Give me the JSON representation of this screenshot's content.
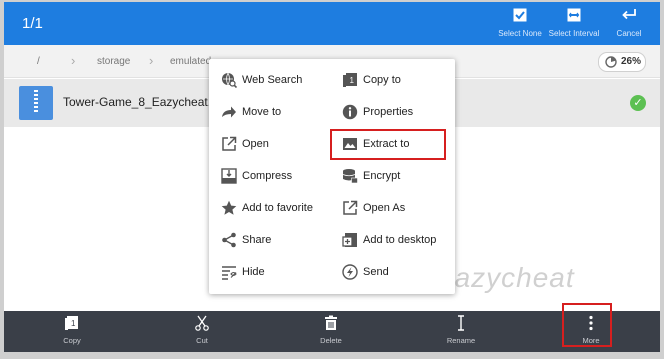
{
  "topbar": {
    "selection_count": "1/1",
    "actions": [
      {
        "label": "Select None",
        "icon": "checkbox-icon"
      },
      {
        "label": "Select Interval",
        "icon": "interval-icon"
      },
      {
        "label": "Cancel",
        "icon": "return-icon"
      }
    ]
  },
  "path": {
    "segments": [
      "/",
      "storage",
      "emulated"
    ],
    "storage_usage": "26%"
  },
  "file": {
    "name": "Tower-Game_8_Eazycheat.zi",
    "icon": "zip-file-icon"
  },
  "menu": {
    "left": [
      {
        "label": "Web Search",
        "icon": "web-search-icon"
      },
      {
        "label": "Move to",
        "icon": "move-arrow-icon"
      },
      {
        "label": "Open",
        "icon": "open-external-icon"
      },
      {
        "label": "Compress",
        "icon": "compress-icon"
      },
      {
        "label": "Add to favorite",
        "icon": "star-icon"
      },
      {
        "label": "Share",
        "icon": "share-icon"
      },
      {
        "label": "Hide",
        "icon": "hide-icon"
      }
    ],
    "right": [
      {
        "label": "Copy to",
        "icon": "copy-to-icon"
      },
      {
        "label": "Properties",
        "icon": "info-icon"
      },
      {
        "label": "Extract to",
        "icon": "extract-icon"
      },
      {
        "label": "Encrypt",
        "icon": "encrypt-icon"
      },
      {
        "label": "Open As",
        "icon": "open-as-icon"
      },
      {
        "label": "Add to desktop",
        "icon": "add-to-desktop-icon"
      },
      {
        "label": "Send",
        "icon": "send-icon"
      }
    ]
  },
  "bottombar": {
    "items": [
      {
        "label": "Copy",
        "icon": "copy-icon"
      },
      {
        "label": "Cut",
        "icon": "scissors-icon"
      },
      {
        "label": "Delete",
        "icon": "trash-icon"
      },
      {
        "label": "Rename",
        "icon": "text-cursor-icon"
      },
      {
        "label": "More",
        "icon": "more-vertical-icon"
      }
    ]
  },
  "watermark": "eazycheat",
  "colors": {
    "accent": "#1e7de0",
    "bottombar": "#3a3f48",
    "highlight_box": "#d61f1f",
    "check": "#5cc052"
  }
}
